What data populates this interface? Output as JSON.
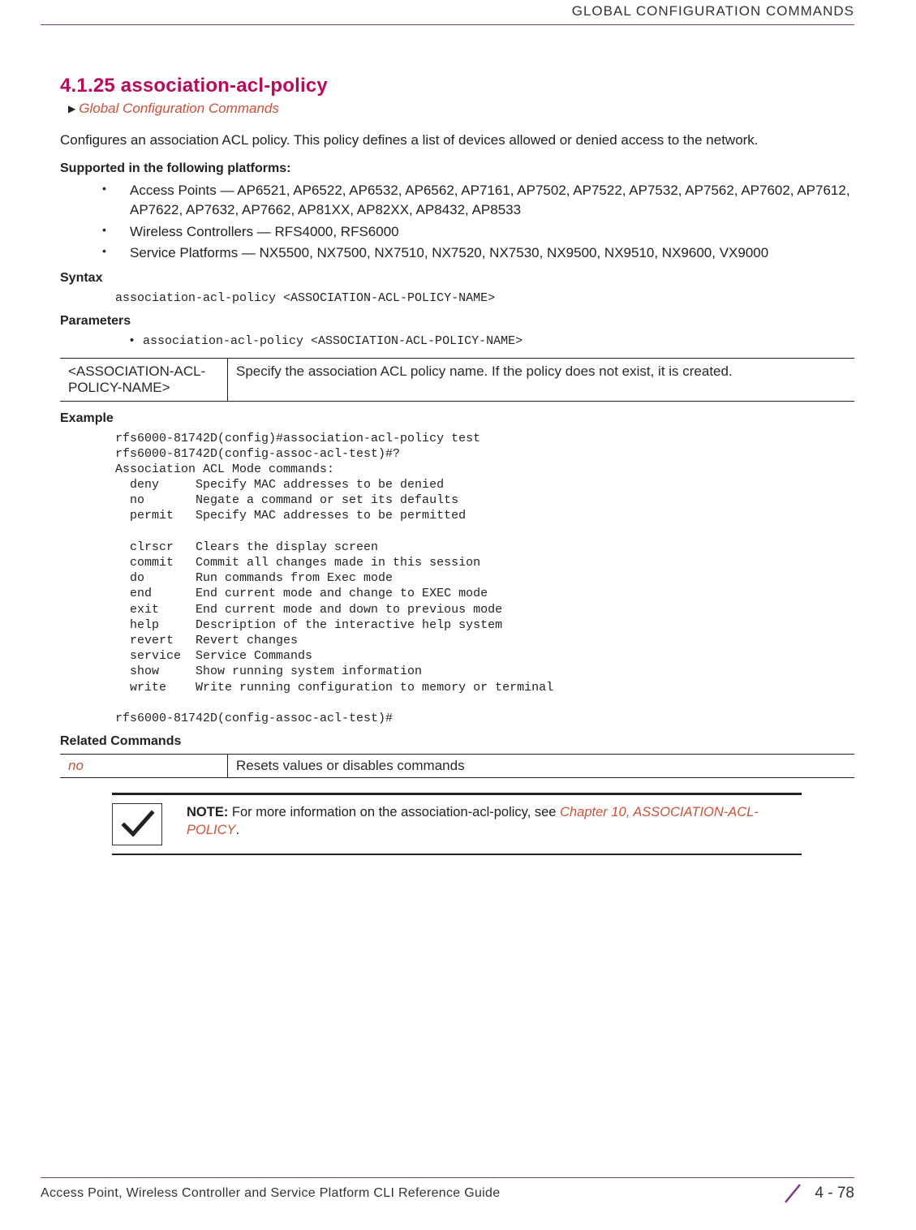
{
  "header": {
    "running_head": "GLOBAL CONFIGURATION COMMANDS"
  },
  "section": {
    "number_title": "4.1.25 association-acl-policy",
    "breadcrumb": "Global Configuration Commands",
    "description": "Configures an association ACL policy. This policy defines a list of devices allowed or denied access to the network."
  },
  "supported": {
    "heading": "Supported in the following platforms:",
    "items": [
      "Access Points — AP6521, AP6522, AP6532, AP6562, AP7161, AP7502, AP7522, AP7532, AP7562, AP7602, AP7612, AP7622, AP7632, AP7662, AP81XX, AP82XX, AP8432, AP8533",
      "Wireless Controllers — RFS4000, RFS6000",
      "Service Platforms — NX5500, NX7500, NX7510, NX7520, NX7530, NX9500, NX9510, NX9600, VX9000"
    ]
  },
  "syntax": {
    "heading": "Syntax",
    "code": "association-acl-policy <ASSOCIATION-ACL-POLICY-NAME>"
  },
  "parameters": {
    "heading": "Parameters",
    "bullet": "• association-acl-policy <ASSOCIATION-ACL-POLICY-NAME>",
    "table_param": "<ASSOCIATION-ACL-POLICY-NAME>",
    "table_desc": "Specify the association ACL policy name. If the policy does not exist, it is created."
  },
  "example": {
    "heading": "Example",
    "code": "rfs6000-81742D(config)#association-acl-policy test\nrfs6000-81742D(config-assoc-acl-test)#?\nAssociation ACL Mode commands:\n  deny     Specify MAC addresses to be denied\n  no       Negate a command or set its defaults\n  permit   Specify MAC addresses to be permitted\n\n  clrscr   Clears the display screen\n  commit   Commit all changes made in this session\n  do       Run commands from Exec mode\n  end      End current mode and change to EXEC mode\n  exit     End current mode and down to previous mode\n  help     Description of the interactive help system\n  revert   Revert changes\n  service  Service Commands\n  show     Show running system information\n  write    Write running configuration to memory or terminal\n\nrfs6000-81742D(config-assoc-acl-test)#"
  },
  "related": {
    "heading": "Related Commands",
    "cmd": "no",
    "desc": "Resets values or disables commands"
  },
  "note": {
    "label": "NOTE:",
    "text_prefix": " For more information on the association-acl-policy, see ",
    "link": "Chapter 10, ASSOCIATION-ACL-POLICY",
    "text_suffix": "."
  },
  "footer": {
    "guide": "Access Point, Wireless Controller and Service Platform CLI Reference Guide",
    "page": "4 - 78"
  }
}
